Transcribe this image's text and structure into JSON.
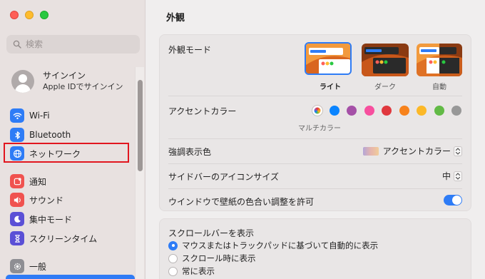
{
  "sidebar": {
    "search_placeholder": "検索",
    "account": {
      "title": "サインイン",
      "subtitle": "Apple IDでサインイン"
    },
    "items": [
      {
        "label": "Wi-Fi",
        "icon": "wifi-icon",
        "color": "#2e7cf6"
      },
      {
        "label": "Bluetooth",
        "icon": "bluetooth-icon",
        "color": "#2e7cf6"
      },
      {
        "label": "ネットワーク",
        "icon": "globe-icon",
        "color": "#2e7cf6"
      },
      {
        "label": "通知",
        "icon": "bell-icon",
        "color": "#f0524f"
      },
      {
        "label": "サウンド",
        "icon": "speaker-icon",
        "color": "#f0524f"
      },
      {
        "label": "集中モード",
        "icon": "moon-icon",
        "color": "#5b50d6"
      },
      {
        "label": "スクリーンタイム",
        "icon": "hourglass-icon",
        "color": "#5b50d6"
      },
      {
        "label": "一般",
        "icon": "gear-icon",
        "color": "#8e8e93"
      }
    ],
    "highlight_color": "#e1161f"
  },
  "main": {
    "title": "外観",
    "appearance": {
      "label": "外観モード",
      "options": [
        {
          "label": "ライト",
          "selected": true
        },
        {
          "label": "ダーク",
          "selected": false
        },
        {
          "label": "自動",
          "selected": false
        }
      ]
    },
    "accent": {
      "label": "アクセントカラー",
      "caption": "マルチカラー",
      "colors": [
        "multicolor",
        "#0a84ff",
        "#a550a7",
        "#f74f9e",
        "#e0383e",
        "#f7821b",
        "#fcb827",
        "#62ba46",
        "#989898"
      ]
    },
    "highlight": {
      "label": "強調表示色",
      "value": "アクセントカラー"
    },
    "sidebar_icon_size": {
      "label": "サイドバーのアイコンサイズ",
      "value": "中"
    },
    "wallpaper_tinting": {
      "label": "ウインドウで壁紙の色合い調整を許可",
      "enabled": true
    },
    "scrollbars": {
      "label": "スクロールバーを表示",
      "options": [
        {
          "label": "マウスまたはトラックパッドに基づいて自動的に表示",
          "selected": true
        },
        {
          "label": "スクロール時に表示",
          "selected": false
        },
        {
          "label": "常に表示",
          "selected": false
        }
      ]
    }
  },
  "colors": {
    "accent": "#2e7cf6",
    "sidebar_bg": "#e8e1e0",
    "content_bg": "#f0eeee"
  }
}
